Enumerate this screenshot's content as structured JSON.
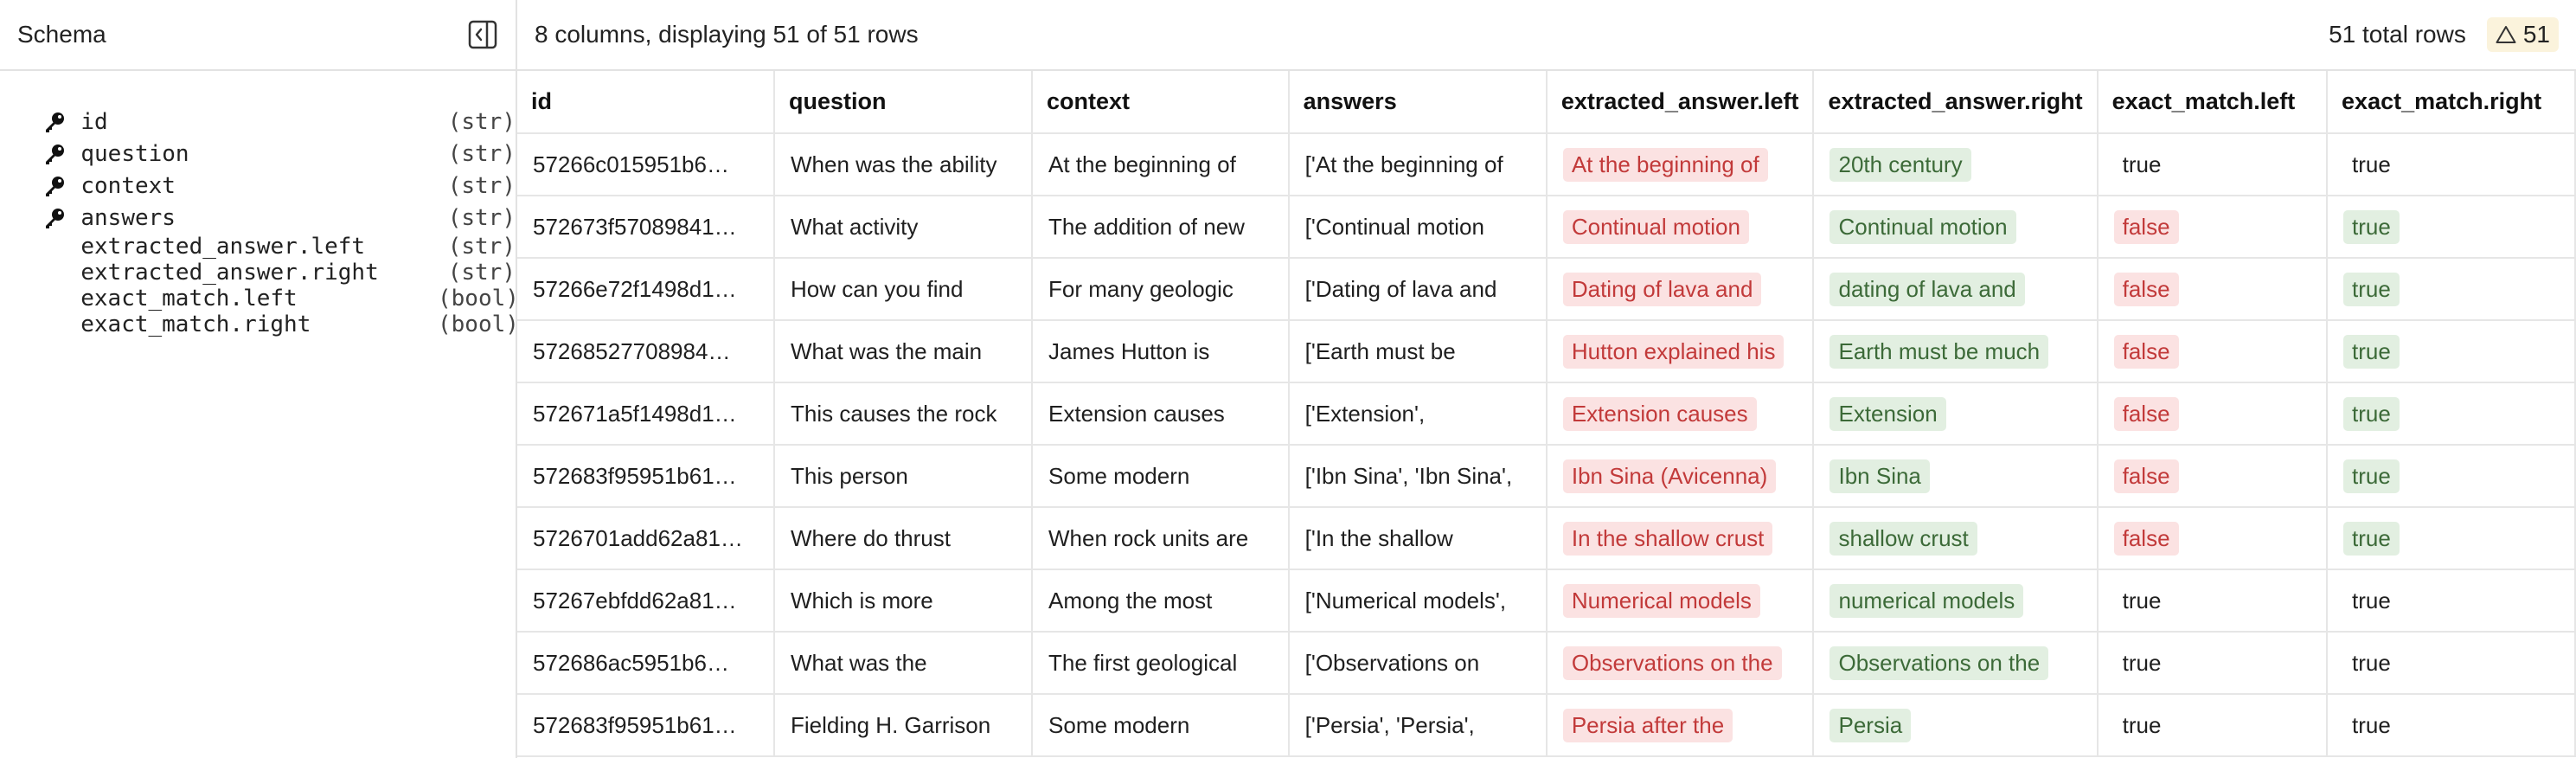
{
  "sidebar": {
    "title": "Schema",
    "fields": [
      {
        "name": "id",
        "type": "(str)",
        "key": true
      },
      {
        "name": "question",
        "type": "(str)",
        "key": true
      },
      {
        "name": "context",
        "type": "(str)",
        "key": true
      },
      {
        "name": "answers",
        "type": "(str)",
        "key": true
      },
      {
        "name": "extracted_answer.left",
        "type": "(str)",
        "key": false
      },
      {
        "name": "extracted_answer.right",
        "type": "(str)",
        "key": false
      },
      {
        "name": "exact_match.left",
        "type": "(bool)",
        "key": false
      },
      {
        "name": "exact_match.right",
        "type": "(bool)",
        "key": false
      }
    ]
  },
  "topbar": {
    "summary": "8 columns, displaying 51 of 51 rows",
    "total_rows": "51 total rows",
    "warning_count": "51"
  },
  "table": {
    "columns": [
      "id",
      "question",
      "context",
      "answers",
      "extracted_answer.left",
      "extracted_answer.right",
      "exact_match.left",
      "exact_match.right"
    ],
    "rows": [
      [
        "57266c015951b6…",
        "When was the ability",
        "At the beginning of",
        "['At the beginning of",
        "At the beginning of",
        "20th century",
        "true",
        "true"
      ],
      [
        "572673f57089841…",
        "What activity",
        "The addition of new",
        "['Continual motion",
        "Continual motion",
        "Continual motion",
        "false",
        "true"
      ],
      [
        "57266e72f1498d1…",
        "How can you find",
        "For many geologic",
        "['Dating of lava and",
        "Dating of lava and",
        "dating of lava and",
        "false",
        "true"
      ],
      [
        "57268527708984…",
        "What was the main",
        "James Hutton is",
        "['Earth must be",
        "Hutton explained his",
        "Earth must be much",
        "false",
        "true"
      ],
      [
        "572671a5f1498d1…",
        "This causes the rock",
        "Extension causes",
        "['Extension',",
        "Extension causes",
        "Extension",
        "false",
        "true"
      ],
      [
        "572683f95951b61…",
        "This person",
        "Some modern",
        "['Ibn Sina', 'Ibn Sina',",
        "Ibn Sina (Avicenna)",
        "Ibn Sina",
        "false",
        "true"
      ],
      [
        "5726701add62a81…",
        "Where do thrust",
        "When rock units are",
        "['In the shallow",
        "In the shallow crust",
        "shallow crust",
        "false",
        "true"
      ],
      [
        "57267ebfdd62a81…",
        "Which is more",
        "Among the most",
        "['Numerical models',",
        "Numerical models",
        "numerical models",
        "true",
        "true"
      ],
      [
        "572686ac5951b6…",
        "What was the",
        "The first geological",
        "['Observations on",
        "Observations on the",
        "Observations on the",
        "true",
        "true"
      ],
      [
        "572683f95951b61…",
        "Fielding H. Garrison",
        "Some modern",
        "['Persia', 'Persia',",
        "Persia after the",
        "Persia",
        "true",
        "true"
      ]
    ]
  },
  "colors": {
    "left_pill_bg": "#fbe2e2",
    "left_pill_fg": "#c23a3a",
    "right_pill_bg": "#e2efe1",
    "right_pill_fg": "#3c6a38",
    "warning_bg": "#fbf3dc"
  },
  "icons": {
    "key": "key-icon",
    "collapse": "sidebar-collapse-icon",
    "warning": "warning-triangle-icon"
  }
}
